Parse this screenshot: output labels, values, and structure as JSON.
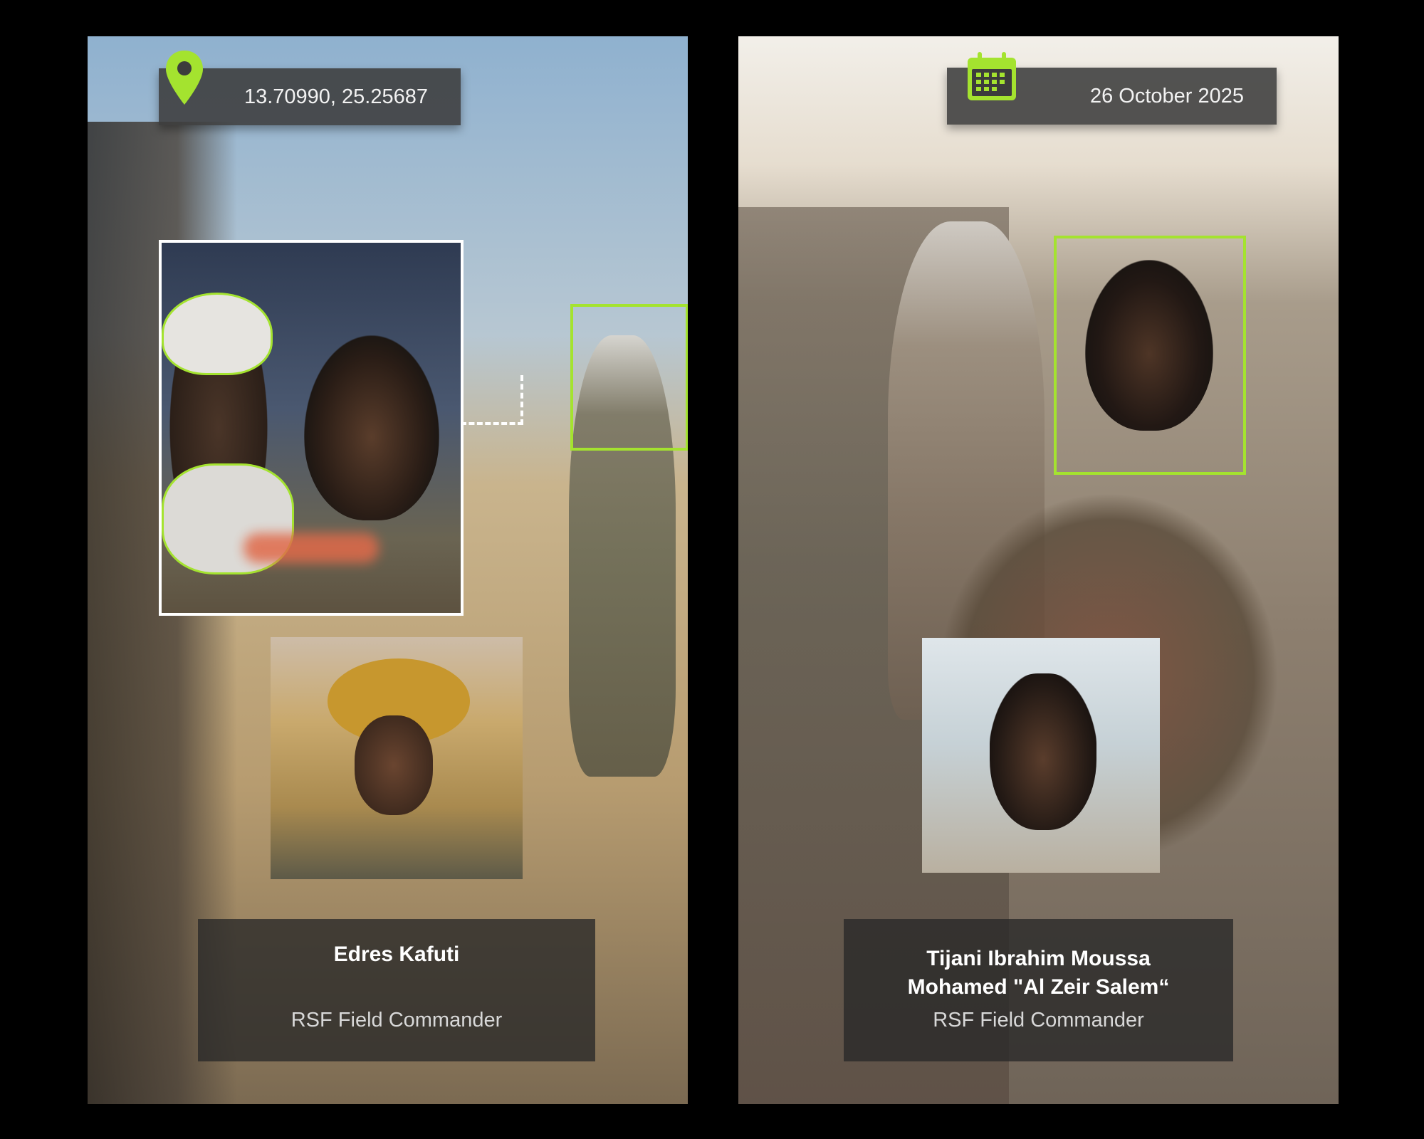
{
  "left_panel": {
    "coordinates": "13.70990, 25.25687",
    "caption": {
      "name": "Edres Kafuti",
      "role": "RSF Field Commander"
    }
  },
  "right_panel": {
    "date": "26 October 2025",
    "caption": {
      "name_line1": "Tijani Ibrahim Moussa",
      "name_line2": "Mohamed \"Al Zeir Salem“",
      "role": "RSF Field Commander"
    }
  },
  "colors": {
    "accent": "#a4e32f",
    "pill_bg": "#3c3c3c",
    "background": "#000000"
  },
  "icons": {
    "location": "map-pin-icon",
    "date": "calendar-icon"
  }
}
